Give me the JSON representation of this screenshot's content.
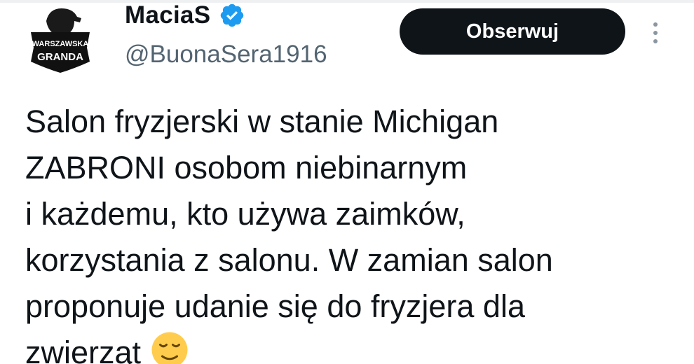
{
  "author": {
    "display_name": "MaciaS",
    "handle": "@BuonaSera1916",
    "avatar_text_line1": "WARSZAWSKA",
    "avatar_text_line2": "GRANDA",
    "verified": true
  },
  "actions": {
    "follow_label": "Obserwuj",
    "more_icon": "more-vertical-icon"
  },
  "tweet": {
    "lines": [
      "Salon fryzjerski w stanie Michigan",
      "ZABRONI osobom niebinarnym",
      "i każdemu, kto używa zaimków,",
      "korzystania z salonu. W zamian salon",
      "proponuje udanie się do fryzjera dla",
      "zwierząt"
    ],
    "emoji": "relieved-face-icon"
  },
  "colors": {
    "text": "#0f1419",
    "secondary_text": "#536471",
    "verified_badge": "#1d9bf0",
    "follow_button_bg": "#0f1419",
    "follow_button_text": "#ffffff"
  }
}
